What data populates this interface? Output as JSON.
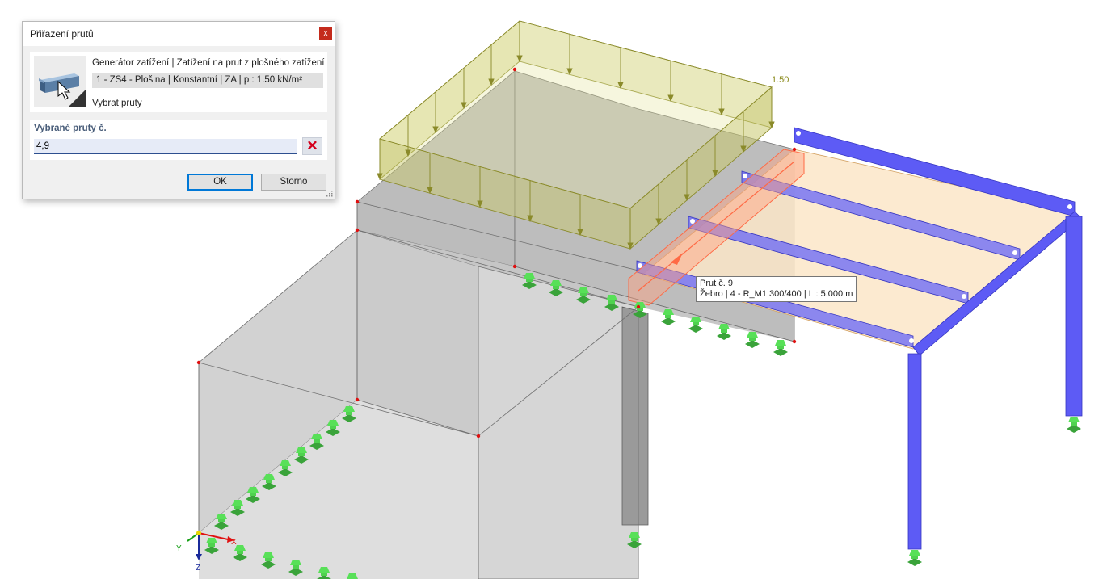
{
  "dialog": {
    "title": "Přiřazení prutů",
    "close_glyph": "x",
    "icon": "beam-pointer-icon",
    "info_line1": "Generátor zatížení | Zatížení na prut z plošného zatížení",
    "info_line2": "1 - ZS4 - Plošina | Konstantní | ZA | p : 1.50 kN/m²",
    "info_line3": "Vybrat pruty",
    "selected_label": "Vybrané pruty č.",
    "selected_value": "4,9",
    "clear_glyph": "✕",
    "ok_label": "OK",
    "cancel_label": "Storno"
  },
  "viewport": {
    "load_value_label": "1.50",
    "axis_x": "X",
    "axis_y": "Y",
    "axis_z": "Z",
    "colors": {
      "load": "#a0a028",
      "steel": "#5d5bf5",
      "support": "#3cc83c",
      "concrete": "#c8c8c8",
      "highlight": "#ff7f50",
      "slab": "#fbe6c8"
    }
  },
  "tooltip": {
    "line1": "Prut č. 9",
    "line2": "Žebro | 4 - R_M1 300/400 | L : 5.000 m"
  }
}
